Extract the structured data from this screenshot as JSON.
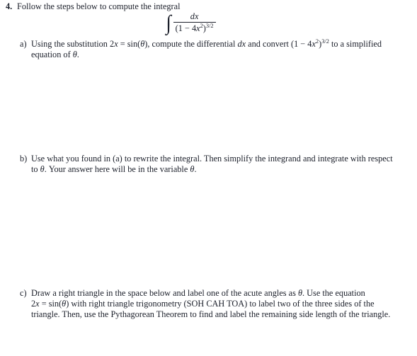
{
  "document": {
    "type": "math-worksheet-problem",
    "text_color": "#1b1f2a",
    "background_color": "#ffffff"
  },
  "problem": {
    "number": "4.",
    "stem": "Follow the steps below to compute the integral",
    "equation": {
      "integral_sign": "∫",
      "numerator": "dx",
      "denominator_open": "(1 − 4",
      "denominator_var": "x",
      "denominator_var_exp": "2",
      "denominator_close": ")",
      "denominator_exp": "3/2",
      "plain": "∫ dx / (1 − 4x²)^(3/2)"
    }
  },
  "parts": [
    {
      "label": "a)",
      "name": "part-a",
      "segments": [
        {
          "kind": "text",
          "value": "Using the substitution "
        },
        {
          "kind": "math",
          "value": "2x = sin(θ)"
        },
        {
          "kind": "text",
          "value": ", compute the differential "
        },
        {
          "kind": "math",
          "value": "dx"
        },
        {
          "kind": "text",
          "value": " and convert "
        },
        {
          "kind": "math",
          "value": "(1 − 4x²)³ᐟ²"
        },
        {
          "kind": "text",
          "value": " to a simplified equation of "
        },
        {
          "kind": "math",
          "value": "θ"
        },
        {
          "kind": "text",
          "value": "."
        }
      ],
      "plain": "Using the substitution 2x = sin(θ), compute the differential dx and convert (1 − 4x²)^(3/2) to a simplified equation of θ."
    },
    {
      "label": "b)",
      "name": "part-b",
      "plain": "Use what you found in (a) to rewrite the integral. Then simplify the integrand and integrate with respect to θ. Your answer here will be in the variable θ."
    },
    {
      "label": "c)",
      "name": "part-c",
      "plain": "Draw a right triangle in the space below and label one of the acute angles as θ. Use the equation 2x = sin(θ) with right triangle trigonometry (SOH CAH TOA) to label two of the three sides of the triangle. Then, use the Pythagorean Theorem to find and label the remaining side length of the triangle."
    }
  ],
  "part_a_text": {
    "t1": "Using the substitution ",
    "m1_num": "2",
    "m1_var": "x",
    "m1_eq": " = ",
    "m1_fn": "sin(",
    "m1_theta": "θ",
    "m1_close": ")",
    "t2": ", compute the differential ",
    "m2": "dx",
    "t3": " and convert ",
    "m3_open": "(1 − 4",
    "m3_var": "x",
    "m3_var_exp": "2",
    "m3_close": ")",
    "m3_exp": "3/2",
    "t4": " to a simplified equation of ",
    "m4_theta": "θ",
    "t5": "."
  },
  "part_b_text": {
    "t1": "Use what you found in (a) to rewrite the integral. Then simplify the integrand and integrate with respect to ",
    "m1_theta": "θ",
    "t2": ". Your answer here will be in the variable ",
    "m2_theta": "θ",
    "t3": "."
  },
  "part_c_text": {
    "t1": "Draw a right triangle in the space below and label one of the acute angles as ",
    "m1_theta": "θ",
    "t2": ". Use the equation ",
    "m2_num": "2",
    "m2_var": "x",
    "m2_eq": " = ",
    "m2_fn": "sin(",
    "m2_theta": "θ",
    "m2_close": ")",
    "t3": " with right triangle trigonometry (SOH CAH TOA) to label two of the three sides of the triangle. Then, use the Pythagorean Theorem to find and label the remaining side length of the triangle."
  },
  "answer_spaces": [
    {
      "name": "answer-space-a",
      "after": "a)"
    },
    {
      "name": "answer-space-b",
      "after": "b)"
    },
    {
      "name": "answer-space-c",
      "after": "c)"
    }
  ]
}
